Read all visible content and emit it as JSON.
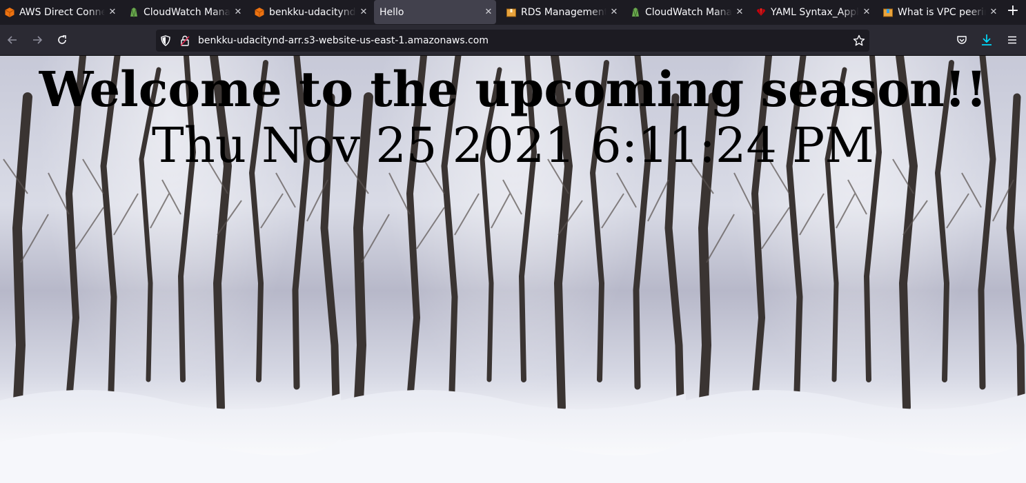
{
  "browser": {
    "tabs": [
      {
        "title": "AWS Direct Connect",
        "favicon": "aws-orange-cube-icon",
        "color": "#ec7211",
        "active": false
      },
      {
        "title": "CloudWatch Manag",
        "favicon": "cloudwatch-green-icon",
        "color": "#6aa84f",
        "active": false
      },
      {
        "title": "benkku-udacitynd-",
        "favicon": "aws-orange-cube-icon",
        "color": "#ec7211",
        "active": false
      },
      {
        "title": "Hello",
        "favicon": "",
        "color": "",
        "active": true
      },
      {
        "title": "RDS Management",
        "favicon": "amazon-package-icon",
        "color": "#e8a33d",
        "active": false
      },
      {
        "title": "CloudWatch Manag",
        "favicon": "cloudwatch-green-icon",
        "color": "#6aa84f",
        "active": false
      },
      {
        "title": "YAML Syntax_Appli",
        "favicon": "huawei-red-icon",
        "color": "#c7000b",
        "active": false
      },
      {
        "title": "What is VPC peerin",
        "favicon": "amazon-package-blue-icon",
        "color": "#e8a33d",
        "active": false
      }
    ],
    "url": "benkku-udacitynd-arr.s3-website-us-east-1.amazonaws.com",
    "accent": "#00ddff"
  },
  "page": {
    "heading": "Welcome to the upcoming season!!",
    "datetime": "Thu Nov 25 2021 6:11:24 PM"
  }
}
